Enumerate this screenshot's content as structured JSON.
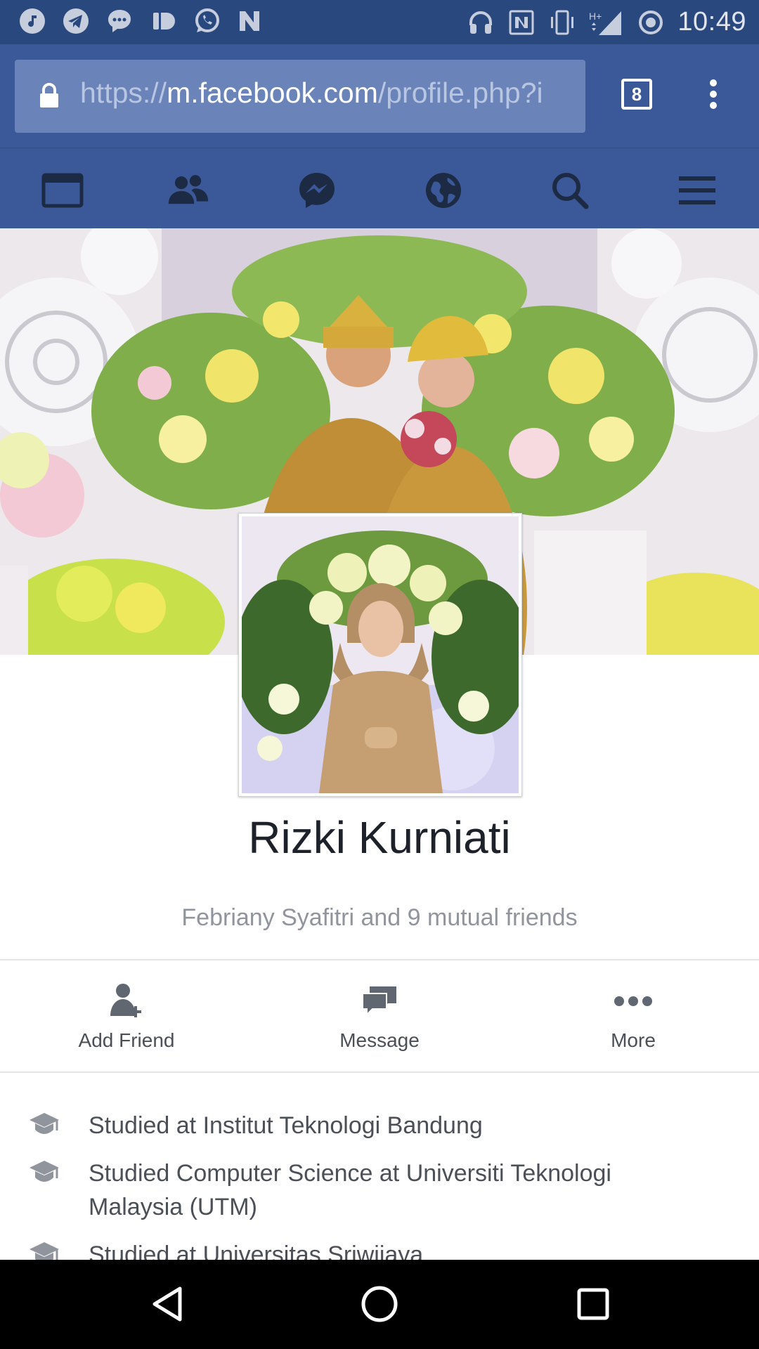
{
  "status_bar": {
    "time": "10:49",
    "left_icons": [
      "music-note-icon",
      "telegram-icon",
      "messenger-bubble-icon",
      "ig-icon",
      "whatsapp-icon",
      "n-app-icon"
    ],
    "right_icons": [
      "headphones-icon",
      "nfc-icon",
      "vibrate-icon",
      "signal-hplus-icon",
      "sync-icon"
    ],
    "network_label": "H+"
  },
  "browser": {
    "url_scheme": "https://",
    "url_host": "m.facebook.com",
    "url_path": "/profile.php?i",
    "tab_count": "8"
  },
  "fb_nav": {
    "items": [
      "news-feed-icon",
      "friends-icon",
      "messenger-icon",
      "globe-icon",
      "search-icon",
      "menu-icon"
    ]
  },
  "profile": {
    "name": "Rizki Kurniati",
    "mutual_friends": "Febriany Syafitri and 9 mutual friends"
  },
  "actions": [
    {
      "label": "Add Friend",
      "icon": "add-friend-icon"
    },
    {
      "label": "Message",
      "icon": "message-icon"
    },
    {
      "label": "More",
      "icon": "more-dots-icon"
    }
  ],
  "education": [
    {
      "text": "Studied at Institut Teknologi Bandung",
      "icon": "graduation-cap-icon"
    },
    {
      "text": "Studied Computer Science at Universiti Teknologi Malaysia (UTM)",
      "icon": "graduation-cap-icon"
    },
    {
      "text": "Studied at Universitas Sriwijaya",
      "icon": "graduation-cap-icon"
    }
  ],
  "colors": {
    "fb_blue": "#3b5998",
    "status_bar": "#29487d",
    "text_dark": "#1d2129",
    "text_grey": "#90949c"
  }
}
